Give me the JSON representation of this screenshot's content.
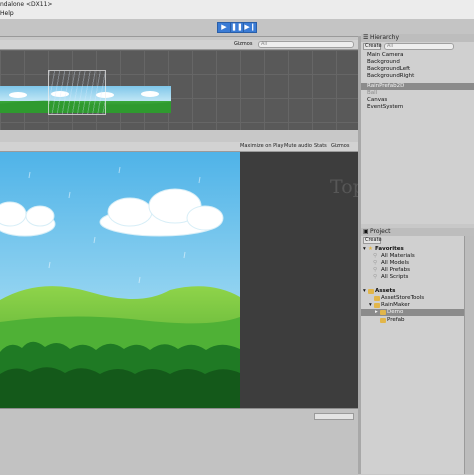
{
  "window": {
    "title": "ndalone <DX11>",
    "menu": "Help"
  },
  "toolbar": {
    "play_icon": "play-icon",
    "pause_icon": "pause-icon",
    "step_icon": "step-icon"
  },
  "scene": {
    "gizmos_label": "Gizmos",
    "search_placeholder": "All"
  },
  "game": {
    "maximize_label": "Maximize on Play",
    "mute_label": "Mute audio",
    "stats_label": "Stats",
    "gizmos_label": "Gizmos"
  },
  "hierarchy": {
    "tab_label": "Hierarchy",
    "create_label": "Create",
    "search_placeholder": "All",
    "items": [
      "Main Camera",
      "Background",
      "BackgroundLeft",
      "BackgroundRight",
      "RainPrefab2D",
      "Ball",
      "Canvas",
      "EventSystem"
    ]
  },
  "project": {
    "tab_label": "Project",
    "create_label": "Create",
    "favorites_label": "Favorites",
    "favorites": [
      "All Materials",
      "All Models",
      "All Prefabs",
      "All Scripts"
    ],
    "assets_label": "Assets",
    "asset_items": [
      "AssetStoreTools",
      "RainMaker",
      "Demo",
      "Prefab"
    ]
  },
  "watermark": {
    "text": "Top Asse"
  },
  "colors": {
    "accent": "#3a7bd5",
    "panel": "#d0d0d0",
    "selection": "#8b8b8b"
  }
}
